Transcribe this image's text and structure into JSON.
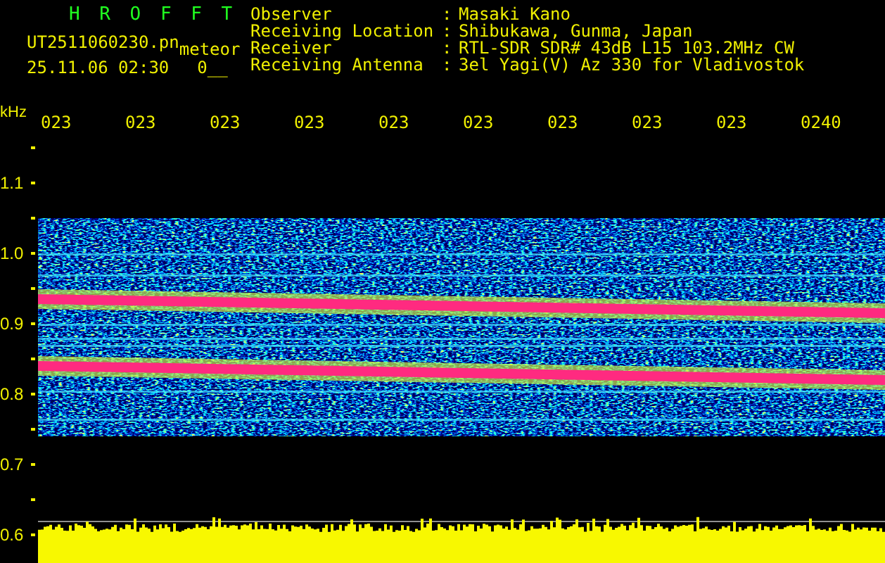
{
  "app": {
    "title": "H R O F F T",
    "file_name": "UT2511060230.pn",
    "mode": "meteor",
    "timestamp": "25.11.06 02:30",
    "counter": "0__"
  },
  "station_info": [
    {
      "label": "Observer",
      "separator": ":",
      "value": "Masaki Kano"
    },
    {
      "label": "Receiving Location",
      "separator": ":",
      "value": "Shibukawa, Gunma, Japan"
    },
    {
      "label": "Receiver",
      "separator": ":",
      "value": "RTL-SDR SDR# 43dB L15 103.2MHz CW"
    },
    {
      "label": "Receiving Antenna",
      "separator": ":",
      "value": "3el Yagi(V) Az 330 for Vladivostok"
    }
  ],
  "time_axis": {
    "labels": [
      "023",
      "023",
      "023",
      "023",
      "023",
      "023",
      "023",
      "023",
      "023",
      "0240"
    ]
  },
  "frequency_axis": {
    "unit": "kHz",
    "labels": [
      "1.1",
      "1.0",
      "0.9",
      "0.8",
      "0.7",
      "0.6"
    ]
  }
}
